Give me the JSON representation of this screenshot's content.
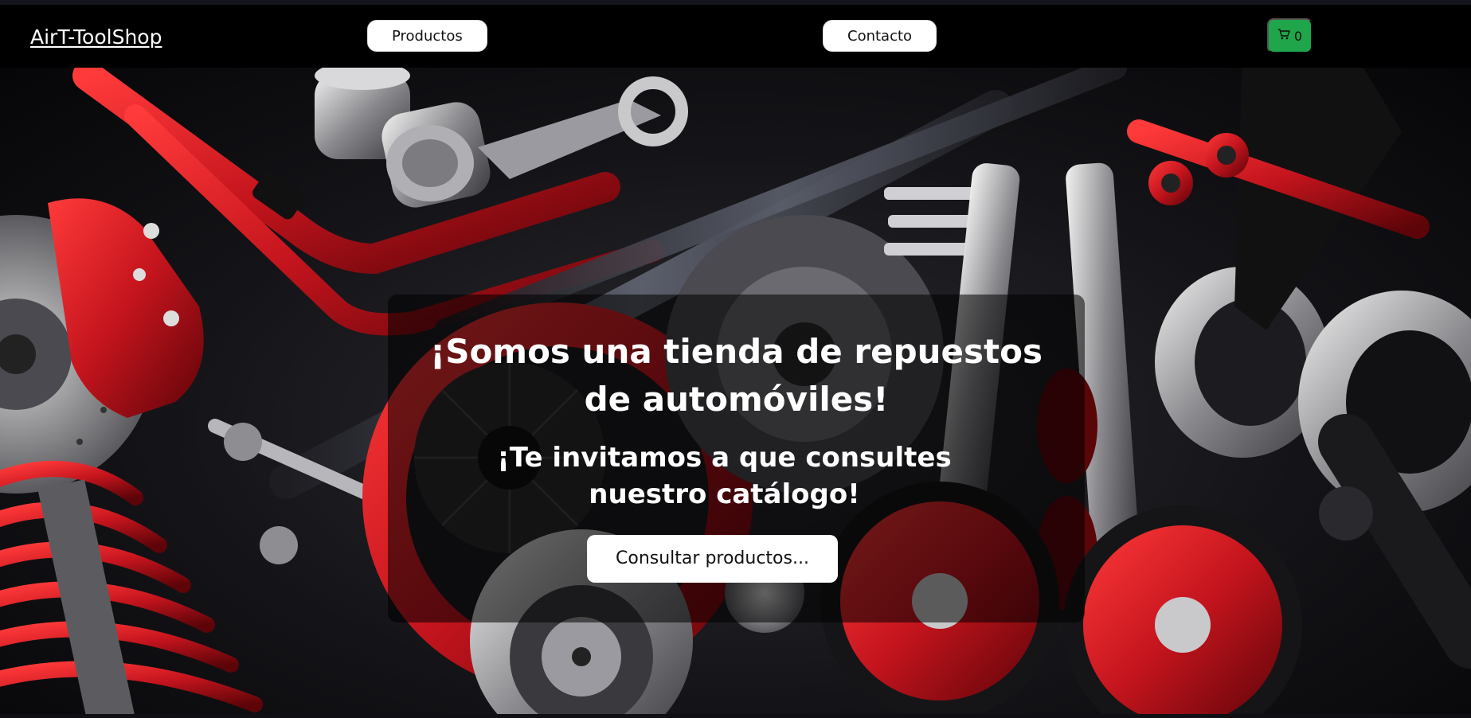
{
  "navbar": {
    "brand": "AirT-ToolShop",
    "links": [
      {
        "label": "Productos"
      },
      {
        "label": "Contacto"
      }
    ],
    "cart": {
      "count": "0",
      "icon": "cart-icon",
      "color": "#1fa64a"
    }
  },
  "hero": {
    "title": "¡Somos una tienda de repuestos de automóviles!",
    "subtitle": "¡Te invitamos a que consultes nuestro catálogo!",
    "cta_label": "Consultar productos...",
    "background": "auto-parts-photo",
    "accent_color": "#c4141d"
  }
}
